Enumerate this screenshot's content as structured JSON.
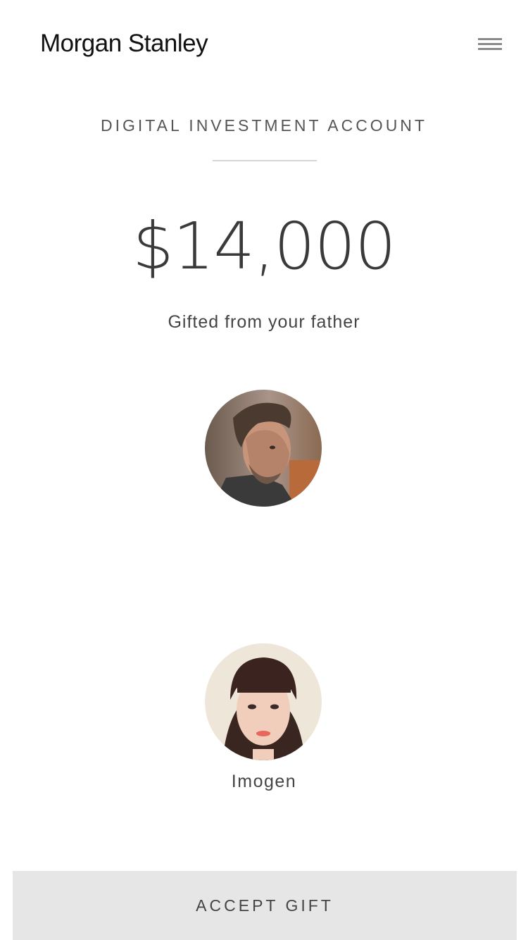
{
  "header": {
    "brand": "Morgan Stanley",
    "menu_icon": "hamburger-menu-icon"
  },
  "account": {
    "title": "DIGITAL INVESTMENT ACCOUNT",
    "amount": "$14,000",
    "gift_from": "Gifted from your father"
  },
  "sender": {
    "avatar": "sender-avatar"
  },
  "recipient": {
    "avatar": "recipient-avatar",
    "name": "Imogen"
  },
  "actions": {
    "accept_label": "ACCEPT GIFT"
  },
  "colors": {
    "background": "#ffffff",
    "button": "#e6e6e6",
    "menu_icon": "#8a8a8a",
    "text": "#444444"
  }
}
